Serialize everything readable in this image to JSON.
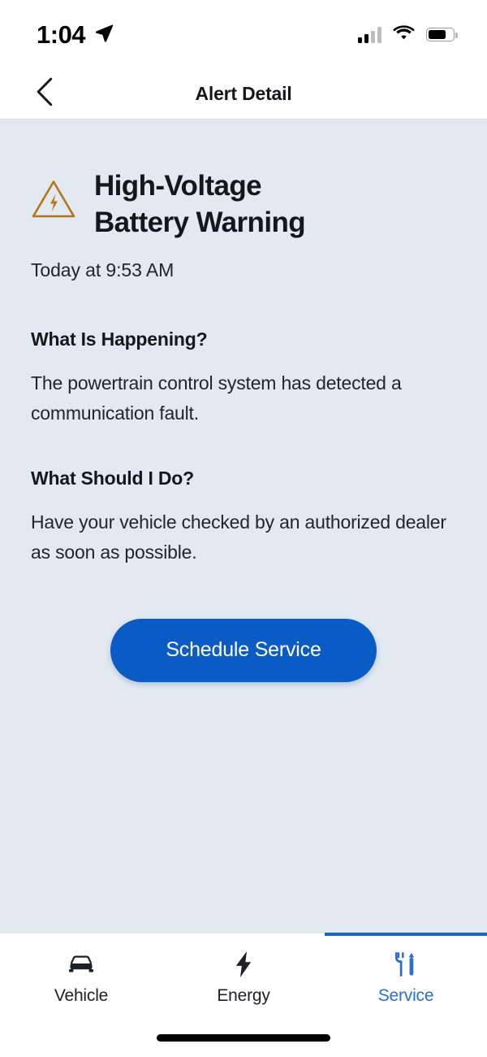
{
  "status_bar": {
    "time": "1:04",
    "location_icon": "location-arrow-icon",
    "signal_icon": "cellular-signal-icon",
    "signal_bars_filled": 2,
    "signal_bars_total": 4,
    "wifi_icon": "wifi-icon",
    "battery_icon": "battery-icon",
    "battery_level_percent": 72
  },
  "nav": {
    "back_icon": "chevron-left-icon",
    "title": "Alert Detail"
  },
  "alert": {
    "icon": "warning-triangle-high-voltage-icon",
    "icon_color": "#b5731a",
    "title": "High-Voltage Battery Warning",
    "timestamp": "Today at 9:53 AM"
  },
  "sections": [
    {
      "heading": "What Is Happening?",
      "body": "The powertrain control system has detected a communication fault."
    },
    {
      "heading": "What Should I Do?",
      "body": "Have your vehicle checked by an authorized dealer as soon as possible."
    }
  ],
  "cta": {
    "label": "Schedule Service",
    "color": "#0b5bc4",
    "text_color": "#ffffff"
  },
  "tabs": [
    {
      "label": "Vehicle",
      "icon": "car-icon",
      "active": false
    },
    {
      "label": "Energy",
      "icon": "lightning-bolt-icon",
      "active": false
    },
    {
      "label": "Service",
      "icon": "wrench-screwdriver-icon",
      "active": true
    }
  ],
  "theme": {
    "content_background": "#e3e9f1",
    "bar_background": "#ffffff",
    "accent": "#1d62c4",
    "active_tab_text": "#2a6fd1",
    "text_primary": "#15171c",
    "text_body": "#22252b"
  },
  "home_indicator": "home-indicator-bar"
}
